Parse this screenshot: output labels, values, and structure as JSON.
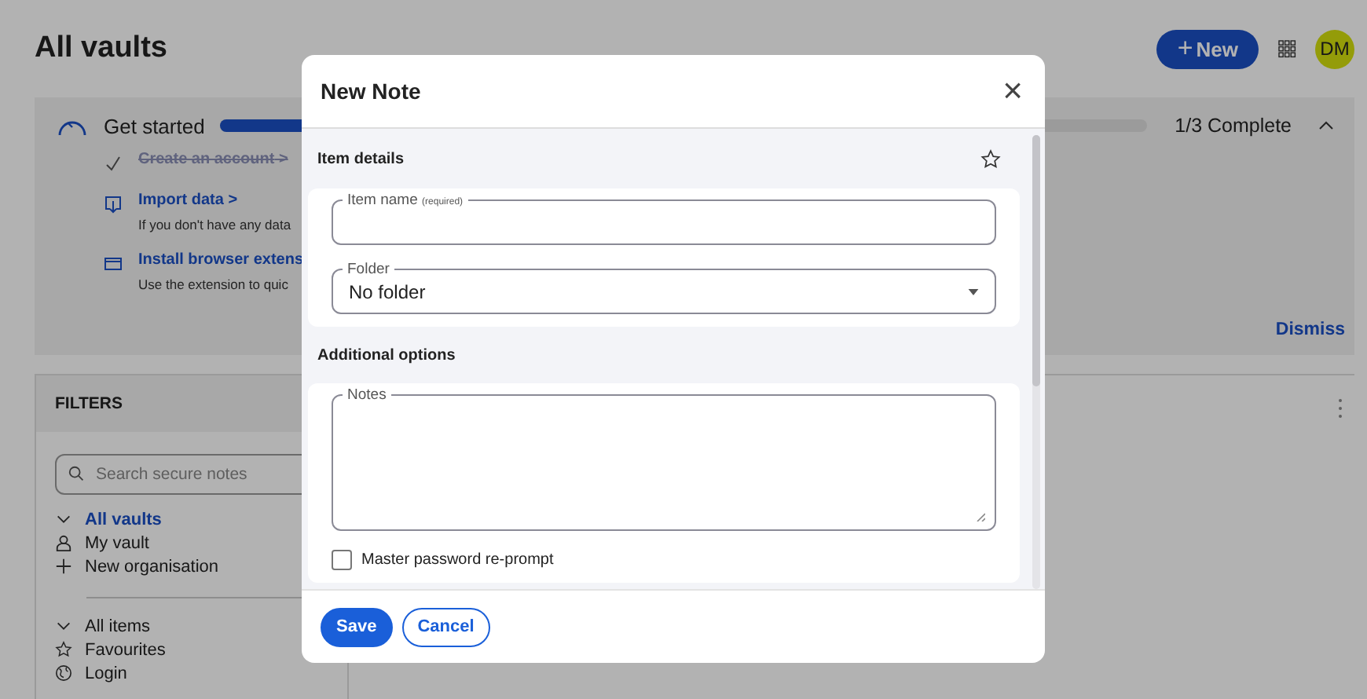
{
  "page": {
    "title": "All vaults"
  },
  "header": {
    "new_button": {
      "icon": "+",
      "label": "New"
    },
    "avatar": "DM"
  },
  "get_started": {
    "title": "Get started",
    "level": 0.3333,
    "progress_text": "1/3 Complete",
    "expanded": true,
    "dismiss": "Dismiss",
    "steps": [
      {
        "kind": "done",
        "label": "Create an account",
        "arrow": ">"
      },
      {
        "kind": "import",
        "label": "Import data",
        "arrow": ">",
        "description": "If you don't have any data"
      },
      {
        "kind": "extension",
        "label": "Install browser extens",
        "description": "Use the extension to quic"
      }
    ]
  },
  "filters": {
    "title": "FILTERS",
    "search": {
      "placeholder": "Search secure notes"
    },
    "groups": [
      {
        "label": "All vaults",
        "selected": true,
        "expanded": true,
        "children": [
          {
            "label": "My vault",
            "kind": "vault",
            "selected": false
          },
          {
            "label": "New organisation",
            "kind": "add",
            "selected": false
          }
        ]
      },
      {
        "label": "All items",
        "selected": false,
        "expanded": true,
        "children": [
          {
            "label": "Favourites",
            "kind": "favourites",
            "selected": false
          },
          {
            "label": "Login",
            "kind": "login",
            "selected": false
          }
        ]
      }
    ]
  },
  "dialog": {
    "title": "New Note",
    "close": "×",
    "item_details": {
      "heading": "Item details",
      "favourite": false,
      "item_name": {
        "label": "Item name",
        "hint": "(required)"
      },
      "folder": {
        "label": "Folder",
        "value": "No folder"
      }
    },
    "additional_options": {
      "heading": "Additional options",
      "notes": {
        "label": "Notes"
      },
      "reprompt": {
        "label": "Master password re-prompt",
        "checked": false
      }
    },
    "buttons": [
      {
        "kind": "primary",
        "label": "Save"
      },
      {
        "kind": "secondary",
        "label": "Cancel"
      }
    ]
  }
}
